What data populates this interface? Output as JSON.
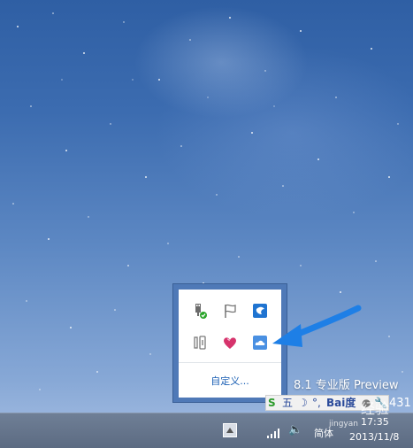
{
  "watermark": {
    "text": "8.1 专业版 Preview"
  },
  "tray_popup": {
    "icons": [
      {
        "name": "usb-safely-remove-icon"
      },
      {
        "name": "action-center-flag-icon"
      },
      {
        "name": "app-blue-icon"
      },
      {
        "name": "app-stand-icon"
      },
      {
        "name": "app-heart-icon"
      },
      {
        "name": "cloud-app-icon"
      }
    ],
    "customize_label": "自定义..."
  },
  "ime_toolbar": {
    "mode_label": "五",
    "brand": "Bai度",
    "ghost_clock": "431"
  },
  "baidu_watermark": {
    "text": "经验",
    "url_fragment": "jingyan"
  },
  "taskbar": {
    "time": "17:35",
    "date": "2013/11/8",
    "ime_label": "简体"
  },
  "colors": {
    "accent_arrow": "#1e7fe6",
    "popup_frame": "#4f79b7",
    "taskbar": "#5f6f86"
  }
}
